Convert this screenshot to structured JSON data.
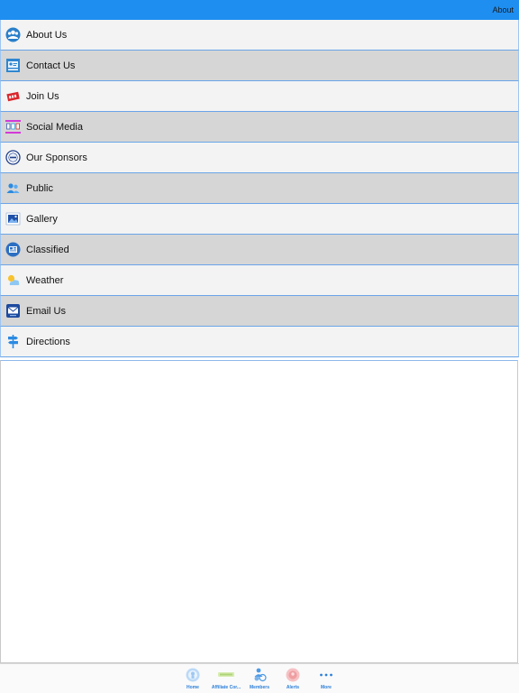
{
  "header": {
    "link_label": "About"
  },
  "menu": {
    "items": [
      {
        "label": "About Us",
        "icon": "people-circle-icon"
      },
      {
        "label": "Contact Us",
        "icon": "contact-card-icon"
      },
      {
        "label": "Join Us",
        "icon": "join-ticket-icon"
      },
      {
        "label": "Social Media",
        "icon": "social-media-icon"
      },
      {
        "label": "Our Sponsors",
        "icon": "sponsor-badge-icon"
      },
      {
        "label": "Public",
        "icon": "public-users-icon"
      },
      {
        "label": "Gallery",
        "icon": "gallery-photo-icon"
      },
      {
        "label": "Classified",
        "icon": "classified-news-icon"
      },
      {
        "label": "Weather",
        "icon": "weather-sun-cloud-icon"
      },
      {
        "label": "Email Us",
        "icon": "email-envelope-icon"
      },
      {
        "label": "Directions",
        "icon": "signpost-icon"
      }
    ]
  },
  "tabbar": {
    "tabs": [
      {
        "label": "Home",
        "icon": "home-icon"
      },
      {
        "label": "Affiliate Cor...",
        "icon": "affiliate-icon"
      },
      {
        "label": "Members",
        "icon": "members-icon"
      },
      {
        "label": "Alerts",
        "icon": "alerts-icon"
      },
      {
        "label": "More",
        "icon": "more-dots-icon"
      }
    ]
  },
  "colors": {
    "header": "#1e8ef0",
    "row_light": "#f3f3f3",
    "row_dark": "#d6d6d6",
    "tab_label": "#2c7fd8"
  }
}
